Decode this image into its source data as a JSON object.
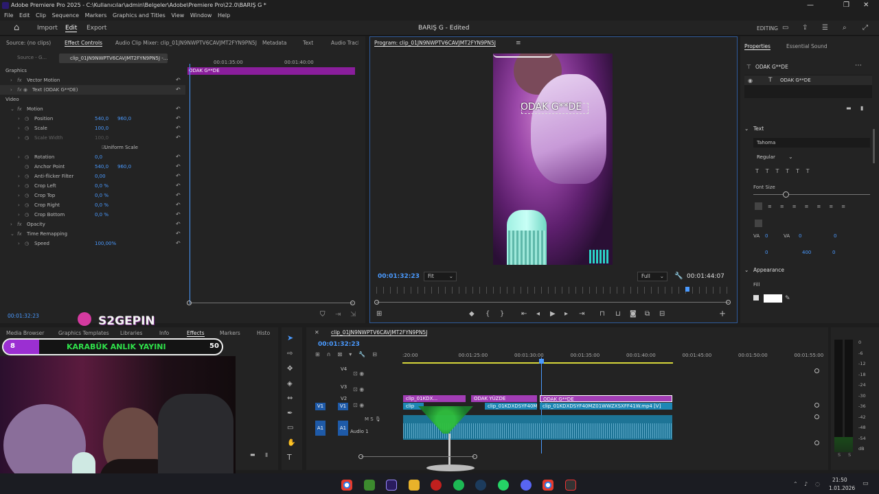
{
  "window": {
    "title": "Adobe Premiere Pro 2025 - C:\\Kullanıcılar\\admin\\Belgeler\\Adobe\\Premiere Pro\\22.0\\BARIŞ G *",
    "minimize": "—",
    "maximize": "❐",
    "close": "✕"
  },
  "menu": [
    "File",
    "Edit",
    "Clip",
    "Sequence",
    "Markers",
    "Graphics and Titles",
    "View",
    "Window",
    "Help"
  ],
  "header": {
    "home": "⌂",
    "import": "Import",
    "edit": "Edit",
    "export": "Export",
    "project": "BARIŞ G - Edited",
    "workspace": "EDITING"
  },
  "effect_controls": {
    "tabs": [
      "Source: (no clips)",
      "Effect Controls",
      "Audio Clip Mixer: clip_01JN9NWPTV6CAVJMT2FYN9PN5J",
      "Metadata",
      "Text",
      "Audio Track"
    ],
    "source_label": "Source - G...",
    "clip_label": "clip_01JN9NWPTV6CAVJMT2FYN9PN5J -...",
    "ruler": [
      "00:01:35:00",
      "00:01:40:00"
    ],
    "track_clip": "ODAK G**DE",
    "current_time": "00:01:32:23",
    "rows": [
      {
        "name": "Graphics",
        "ind": 0,
        "chev": "",
        "fx": "",
        "v1": "",
        "v2": ""
      },
      {
        "name": "Vector Motion",
        "ind": 1,
        "chev": "›",
        "fx": "fx",
        "v1": "",
        "v2": ""
      },
      {
        "name": "Text (ODAK G**DE)",
        "ind": 1,
        "chev": "›",
        "fx": "fx ◉",
        "v1": "",
        "v2": ""
      },
      {
        "name": "Video",
        "ind": 0,
        "chev": "",
        "fx": "",
        "v1": "",
        "v2": ""
      },
      {
        "name": "Motion",
        "ind": 1,
        "chev": "⌄",
        "fx": "fx",
        "v1": "",
        "v2": ""
      },
      {
        "name": "Position",
        "ind": 2,
        "chev": "›",
        "fx": "◷",
        "v1": "540,0",
        "v2": "960,0"
      },
      {
        "name": "Scale",
        "ind": 2,
        "chev": "›",
        "fx": "◷",
        "v1": "100,0",
        "v2": ""
      },
      {
        "name": "Scale Width",
        "ind": 2,
        "chev": "›",
        "fx": "◷",
        "v1": "100,0",
        "v2": ""
      },
      {
        "name": "Uniform Scale",
        "ind": 3,
        "chev": "",
        "fx": "☑",
        "v1": "",
        "v2": ""
      },
      {
        "name": "Rotation",
        "ind": 2,
        "chev": "›",
        "fx": "◷",
        "v1": "0,0",
        "v2": ""
      },
      {
        "name": "Anchor Point",
        "ind": 2,
        "chev": "",
        "fx": "◷",
        "v1": "540,0",
        "v2": "960,0"
      },
      {
        "name": "Anti-flicker Filter",
        "ind": 2,
        "chev": "›",
        "fx": "◷",
        "v1": "0,00",
        "v2": ""
      },
      {
        "name": "Crop Left",
        "ind": 2,
        "chev": "›",
        "fx": "◷",
        "v1": "0,0 %",
        "v2": ""
      },
      {
        "name": "Crop Top",
        "ind": 2,
        "chev": "›",
        "fx": "◷",
        "v1": "0,0 %",
        "v2": ""
      },
      {
        "name": "Crop Right",
        "ind": 2,
        "chev": "›",
        "fx": "◷",
        "v1": "0,0 %",
        "v2": ""
      },
      {
        "name": "Crop Bottom",
        "ind": 2,
        "chev": "›",
        "fx": "◷",
        "v1": "0,0 %",
        "v2": ""
      },
      {
        "name": "Opacity",
        "ind": 1,
        "chev": "›",
        "fx": "fx",
        "v1": "",
        "v2": ""
      },
      {
        "name": "Time Remapping",
        "ind": 1,
        "chev": "⌄",
        "fx": "fx",
        "v1": "",
        "v2": ""
      },
      {
        "name": "Speed",
        "ind": 2,
        "chev": "›",
        "fx": "◷",
        "v1": "100,00%",
        "v2": ""
      }
    ]
  },
  "program": {
    "tab": "Program: clip_01JN9NWPTV6CAVJMT2FYN9PN5J",
    "title_text": "ODAK G**DE",
    "timecode": "00:01:32:23",
    "fit": "Fit",
    "quality": "Full",
    "duration": "00:01:44:07"
  },
  "properties": {
    "tabs": [
      "Properties",
      "Essential Sound"
    ],
    "layer": "ODAK G**DE",
    "layer_item": "ODAK G**DE",
    "section_text": "Text",
    "font": "Tahoma",
    "style": "Regular",
    "font_size": "Font Size",
    "section_appearance": "Appearance",
    "fill": "Fill",
    "tracking_vals": [
      "0",
      "0",
      "0",
      "0",
      "400",
      "0"
    ]
  },
  "project_tabs": [
    "Media Browser",
    "Graphics Templates",
    "Libraries",
    "Info",
    "Effects",
    "Markers",
    "Histo"
  ],
  "overlay": {
    "brand": "S2GEPIN",
    "banner_left": "8",
    "banner_text": "KARABÜK ANLIK YAYINI",
    "banner_right": "50"
  },
  "timeline": {
    "seq": "clip_01JN9NWPTV6CAVJMT2FYN9PN5J",
    "timecode": "00:01:32:23",
    "ruler": [
      ":20:00",
      "00:01:25:00",
      "00:01:30:00",
      "00:01:35:00",
      "00:01:40:00",
      "00:01:45:00",
      "00:01:50:00",
      "00:01:55:00"
    ],
    "tracks": [
      "V4",
      "V3",
      "V2",
      "V1",
      "A1"
    ],
    "audio_label": "Audio 1",
    "clips": {
      "v2a": "clip_01KDX...",
      "v2b": "ODAK YÜZDE",
      "v2c": "ODAK G**DE",
      "v1a": "clip_01KDXDSYF40M...",
      "v1b": "clip_01KDXDSYF40MZ01WWZXSXFF41W.mp4 [V]",
      "v1_short": "clip"
    }
  },
  "meter": [
    "0",
    "-6",
    "-12",
    "-18",
    "-24",
    "-30",
    "-36",
    "-42",
    "-48",
    "-54",
    "dB"
  ],
  "meter_solo": [
    "S",
    "S"
  ],
  "taskbar": {
    "time": "21:50",
    "date": "1.01.2026"
  },
  "colors": {
    "accent": "#4a9aff",
    "clip_purple": "#a23db5",
    "clip_blue": "#1e87b5",
    "banner_green": "#2fe04a"
  }
}
